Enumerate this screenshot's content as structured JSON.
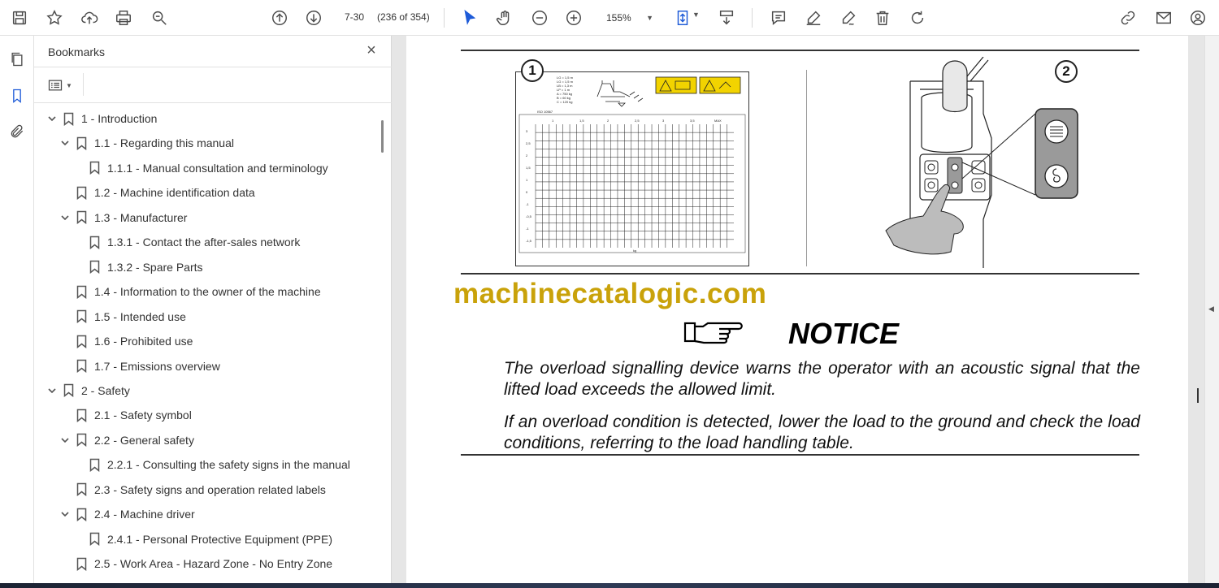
{
  "toolbar": {
    "page_current": "7-30",
    "page_info": "(236 of 354)",
    "zoom": "155%"
  },
  "panel": {
    "title": "Bookmarks",
    "items": [
      {
        "label": "1  -  Introduction",
        "level": 0,
        "expanded": true
      },
      {
        "label": "1.1 - Regarding this manual",
        "level": 1,
        "expanded": true
      },
      {
        "label": "1.1.1 - Manual consultation and terminology",
        "level": 2,
        "expanded": null
      },
      {
        "label": "1.2 - Machine identification data",
        "level": 1,
        "expanded": null
      },
      {
        "label": "1.3 - Manufacturer",
        "level": 1,
        "expanded": true
      },
      {
        "label": "1.3.1 - Contact the after-sales network",
        "level": 2,
        "expanded": null
      },
      {
        "label": "1.3.2 - Spare Parts",
        "level": 2,
        "expanded": null
      },
      {
        "label": "1.4 - Information to the owner of the machine",
        "level": 1,
        "expanded": null
      },
      {
        "label": "1.5 - Intended use",
        "level": 1,
        "expanded": null
      },
      {
        "label": "1.6 - Prohibited use",
        "level": 1,
        "expanded": null
      },
      {
        "label": "1.7 - Emissions overview",
        "level": 1,
        "expanded": null
      },
      {
        "label": "2  -  Safety",
        "level": 0,
        "expanded": true
      },
      {
        "label": "2.1 - Safety symbol",
        "level": 1,
        "expanded": null
      },
      {
        "label": "2.2 - General safety",
        "level": 1,
        "expanded": true
      },
      {
        "label": "2.2.1 - Consulting the safety signs in the manual",
        "level": 2,
        "expanded": null
      },
      {
        "label": "2.3 - Safety signs and operation related labels",
        "level": 1,
        "expanded": null
      },
      {
        "label": "2.4 - Machine driver",
        "level": 1,
        "expanded": true
      },
      {
        "label": "2.4.1 - Personal Protective Equipment (PPE)",
        "level": 2,
        "expanded": null
      },
      {
        "label": "2.5 - Work Area - Hazard Zone - No Entry Zone",
        "level": 1,
        "expanded": null
      }
    ]
  },
  "document": {
    "figure1_label": "1",
    "figure2_label": "2",
    "chart_header": "ISO 10567",
    "chart_footer": "kg",
    "chart_max_label": "MAX",
    "chart_row_labels": [
      "3",
      "2,5",
      "2",
      "1,5",
      "1",
      "0",
      "-1",
      "-0,5",
      "-1",
      "-1,5"
    ],
    "chart_col_labels": [
      "1",
      "1,5",
      "2",
      "2,5",
      "3",
      "3,5"
    ],
    "watermark": "machinecatalogic.com",
    "notice_title": "NOTICE",
    "paragraph1": "The overload signalling device warns the operator with an acoustic signal that the lifted load exceeds the allowed limit.",
    "paragraph2": "If an overload condition is detected, lower the load to the ground and check the load conditions, referring to the load handling table."
  },
  "colors": {
    "watermark": "#c9a20a",
    "warning_yellow": "#f2d300"
  }
}
